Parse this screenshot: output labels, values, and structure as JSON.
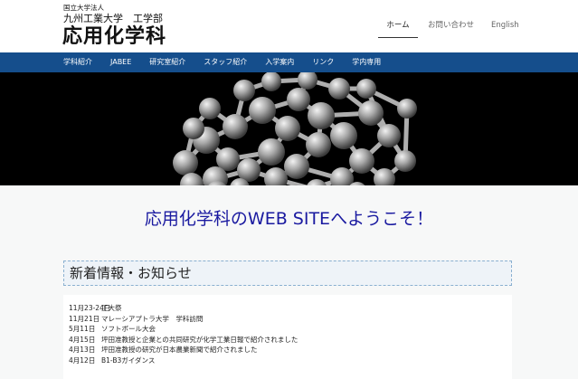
{
  "header": {
    "org_small": "国立大学法人",
    "org_mid": "九州工業大学　工学部",
    "dept_title": "応用化学科",
    "top_links": {
      "home": "ホーム",
      "contact": "お問い合わせ",
      "english": "English"
    }
  },
  "nav": {
    "items": [
      "学科紹介",
      "JABEE",
      "研究室紹介",
      "スタッフ紹介",
      "入学案内",
      "リンク",
      "学内専用"
    ]
  },
  "hero": {
    "image": "fullerene-molecule-image"
  },
  "main": {
    "welcome": "応用化学科のWEB SITEへようこそ！",
    "news_heading": "新着情報・お知らせ",
    "news": [
      {
        "date": "11月23-24日",
        "text": "工大祭"
      },
      {
        "date": "11月21日",
        "text": "マレーシアプトラ大学　学科訪問"
      },
      {
        "date": "5月11日",
        "text": "ソフトボール大会"
      },
      {
        "date": "4月15日",
        "text": "坪田准教授と企業との共同研究が化学工業日報で紹介されました"
      },
      {
        "date": "4月13日",
        "text": "坪田准教授の研究が日本農業新聞で紹介されました"
      },
      {
        "date": "4月12日",
        "text": "B1-B3ガイダンス"
      }
    ]
  },
  "colors": {
    "nav_bg": "#154e8c",
    "welcome_text": "#1a1aa0",
    "hero_bg": "#000000"
  }
}
